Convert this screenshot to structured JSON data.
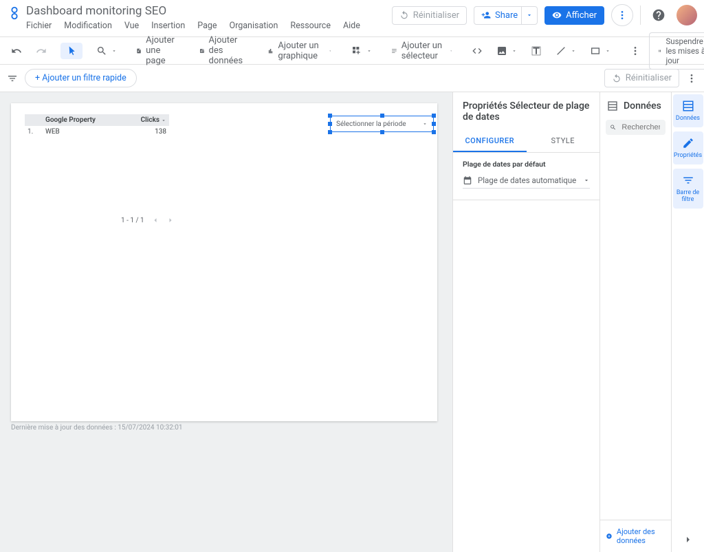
{
  "header": {
    "title": "Dashboard monitoring SEO",
    "menus": [
      "Fichier",
      "Modification",
      "Vue",
      "Insertion",
      "Page",
      "Organisation",
      "Ressource",
      "Aide"
    ],
    "reset": "Réinitialiser",
    "share": "Share",
    "view": "Afficher"
  },
  "toolbar": {
    "add_page": "Ajouter une page",
    "add_data": "Ajouter des données",
    "add_chart": "Ajouter un graphique",
    "add_selector": "Ajouter un sélecteur",
    "pause": "Suspendre les mises à jour"
  },
  "filterbar": {
    "add_filter": "+ Ajouter un filtre rapide",
    "reset": "Réinitialiser"
  },
  "canvas": {
    "table": {
      "col_property": "Google Property",
      "col_clicks": "Clicks",
      "rows": [
        {
          "idx": "1.",
          "property": "WEB",
          "clicks": "138"
        }
      ],
      "pager": "1 - 1 / 1"
    },
    "date_selector_text": "Sélectionner la période",
    "timestamp": "Dernière mise à jour des données : 15/07/2024 10:32:01"
  },
  "props": {
    "title": "Propriétés Sélecteur de plage de dates",
    "tab_config": "CONFIGURER",
    "tab_style": "STYLE",
    "field_label": "Plage de dates par défaut",
    "field_value": "Plage de dates automatique"
  },
  "data_panel": {
    "title": "Données",
    "search_placeholder": "Rechercher",
    "add_data": "Ajouter des données"
  },
  "rail": {
    "data": "Données",
    "props": "Propriétés",
    "filter": "Barre de filtre"
  }
}
